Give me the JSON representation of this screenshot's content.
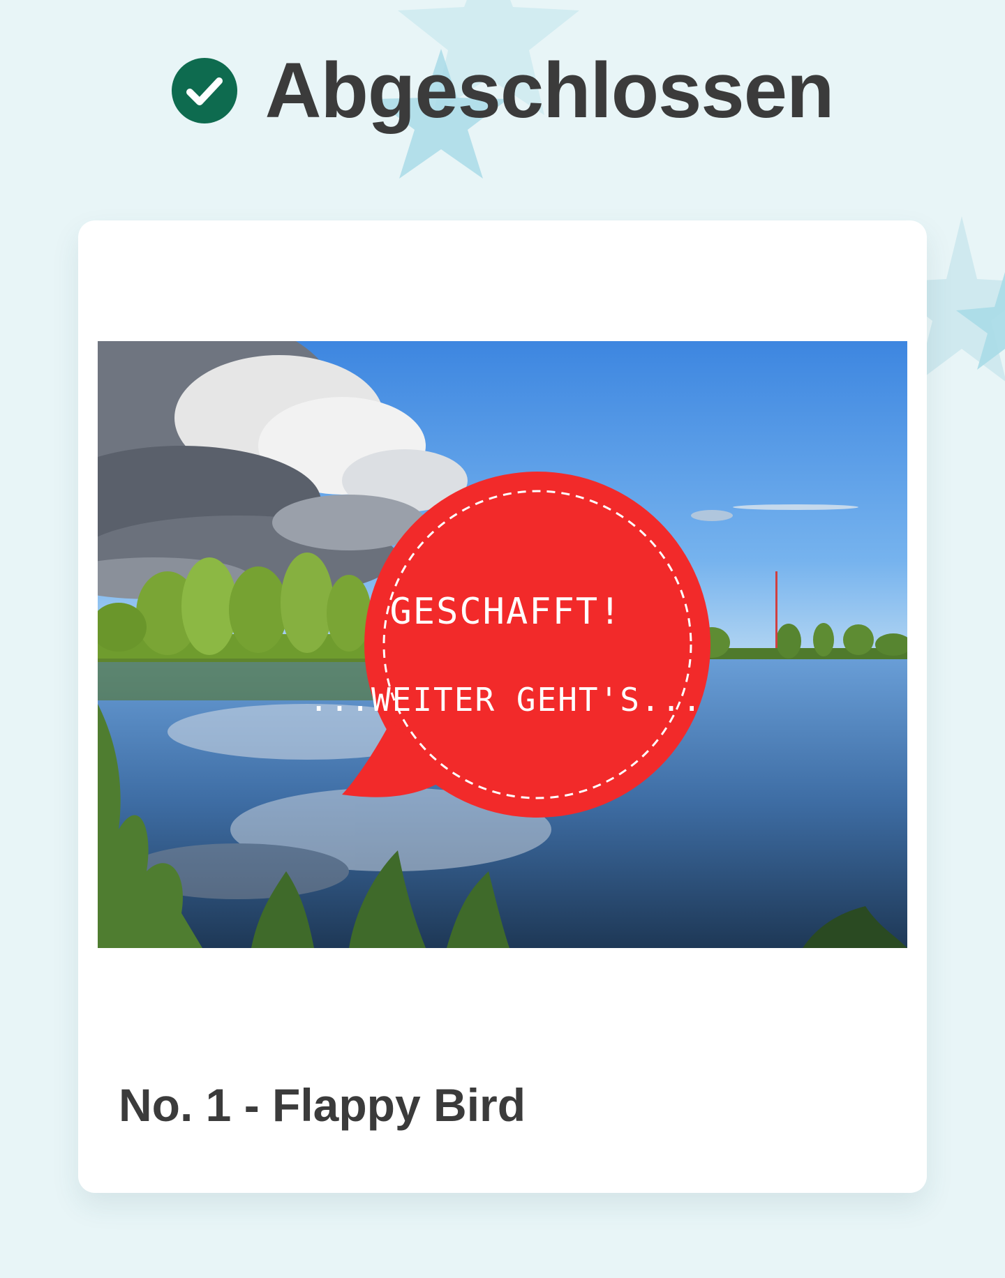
{
  "header": {
    "title": "Abgeschlossen",
    "status_icon": "check-circle-icon",
    "status_color": "#0e6b4f"
  },
  "card": {
    "title": "No. 1 - Flappy Bird",
    "image": {
      "subject": "lake landscape with speech bubble",
      "bubble_line1": "GESCHAFFT!",
      "bubble_line2": "...WEITER GEHT'S...",
      "bubble_color": "#f22a2a"
    }
  },
  "colors": {
    "background": "#e8f5f7",
    "star": "#bfe3ea",
    "text": "#3b3b3b"
  }
}
